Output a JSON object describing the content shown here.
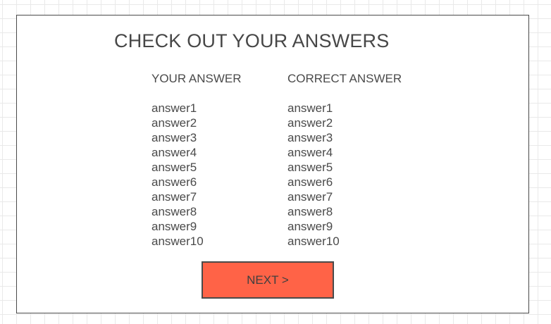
{
  "page": {
    "title": "CHECK OUT YOUR ANSWERS"
  },
  "columns": {
    "your_answer_header": "YOUR ANSWER",
    "correct_answer_header": "CORRECT ANSWER"
  },
  "your_answers": [
    "answer1",
    "answer2",
    "answer3",
    "answer4",
    "answer5",
    "answer6",
    "answer7",
    "answer8",
    "answer9",
    "answer10"
  ],
  "correct_answers": [
    "answer1",
    "answer2",
    "answer3",
    "answer4",
    "answer5",
    "answer6",
    "answer7",
    "answer8",
    "answer9",
    "answer10"
  ],
  "actions": {
    "next_label": "NEXT >"
  },
  "colors": {
    "next_button_background": "#ff6347",
    "border": "#4a4a4a",
    "text": "#4a4a4a",
    "grid_line": "#e9e9e9"
  }
}
